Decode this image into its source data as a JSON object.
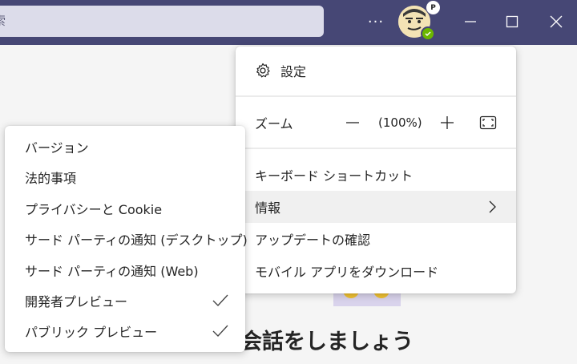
{
  "titlebar": {
    "search_text": "索",
    "more_glyph": "···",
    "avatar_badge": "P"
  },
  "background": {
    "heading": "会話をしましょう"
  },
  "menu": {
    "settings": "設定",
    "zoom_label": "ズーム",
    "zoom_value": "(100%)",
    "keyboard_shortcuts": "キーボード ショートカット",
    "info": "情報",
    "check_updates": "アップデートの確認",
    "mobile_app": "モバイル アプリをダウンロード"
  },
  "submenu": {
    "items": [
      {
        "label": "バージョン",
        "checked": false
      },
      {
        "label": "法的事項",
        "checked": false
      },
      {
        "label": "プライバシーと Cookie",
        "checked": false
      },
      {
        "label": "サード パーティの通知 (デスクトップ)",
        "checked": false
      },
      {
        "label": "サード パーティの通知 (Web)",
        "checked": false
      },
      {
        "label": "開発者プレビュー",
        "checked": true
      },
      {
        "label": "パブリック プレビュー",
        "checked": true
      }
    ]
  },
  "colors": {
    "titlebar": "#464775",
    "presence_available": "#6bb700"
  },
  "icons": [
    "gear-icon",
    "minus-icon",
    "plus-icon",
    "fit-to-window-icon",
    "chevron-right-icon",
    "checkmark-icon",
    "window-minimize-icon",
    "window-maximize-icon",
    "window-close-icon"
  ]
}
